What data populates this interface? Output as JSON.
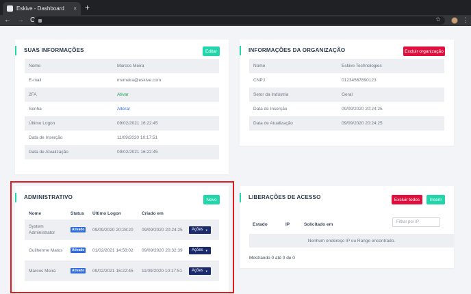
{
  "browser": {
    "tab_title": "Eskive - Dashboard",
    "tab_close": "×",
    "new_tab": "+",
    "nav_back": "←",
    "nav_forward": "→",
    "nav_reload": "C",
    "star": "☆",
    "menu": "⋮"
  },
  "user_info": {
    "title": "SUAS INFORMAÇÕES",
    "edit_label": "Editar",
    "rows": [
      {
        "key": "Nome",
        "value": "Marcos Meira"
      },
      {
        "key": "E-mail",
        "value": "mvmeira@eskive.com"
      },
      {
        "key": "2FA",
        "value": "Ativar"
      },
      {
        "key": "Senha",
        "value": "Alterar"
      },
      {
        "key": "Último Logon",
        "value": "09/02/2021 16:22:45"
      },
      {
        "key": "Data de Inserção",
        "value": "11/09/2020 10:17:51"
      },
      {
        "key": "Data de Atualização",
        "value": "09/02/2021 16:22:45"
      }
    ]
  },
  "org_info": {
    "title": "INFORMAÇÕES DA ORGANIZAÇÃO",
    "delete_label": "Excluir organização",
    "rows": [
      {
        "key": "Nome",
        "value": "Eskive Technologies"
      },
      {
        "key": "CNPJ",
        "value": "01234567890123"
      },
      {
        "key": "Setor da Indústria",
        "value": "Geral"
      },
      {
        "key": "Data de Inserção",
        "value": "09/09/2020 20:24:25"
      },
      {
        "key": "Data de Atualização",
        "value": "09/09/2020 20:24:25"
      }
    ]
  },
  "admin": {
    "title": "ADMINISTRATIVO",
    "new_label": "Novo",
    "columns": [
      "Nome",
      "Status",
      "Último Logon",
      "Criado em"
    ],
    "rows": [
      {
        "name": "System Administrator",
        "status": "Ativado",
        "last_logon": "09/09/2020 20:28:20",
        "created": "09/09/2020 20:24:25",
        "action": "Ações"
      },
      {
        "name": "Guilherme Matos",
        "status": "Ativado",
        "last_logon": "01/02/2021 14:58:02",
        "created": "09/09/2020 20:32:39",
        "action": "Ações"
      },
      {
        "name": "Marcos Meira",
        "status": "Ativado",
        "last_logon": "09/02/2021 16:22:45",
        "created": "11/09/2020 10:17:51",
        "action": "Ações"
      }
    ]
  },
  "access": {
    "title": "LIBERAÇÕES DE ACESSO",
    "delete_all_label": "Excluir todos",
    "insert_label": "Inserir",
    "filter_placeholder": "Filtrar por IP",
    "columns": [
      "Estado",
      "IP",
      "Solicitado em"
    ],
    "empty_message": "Nenhum endereço IP ou Range encontrado.",
    "showing": "Mostrando 0 até 0 de 0"
  },
  "colors": {
    "accent": "#23d5ab",
    "danger": "#e0103e",
    "primary": "#1b2a6b",
    "highlight": "#e01b1b"
  }
}
